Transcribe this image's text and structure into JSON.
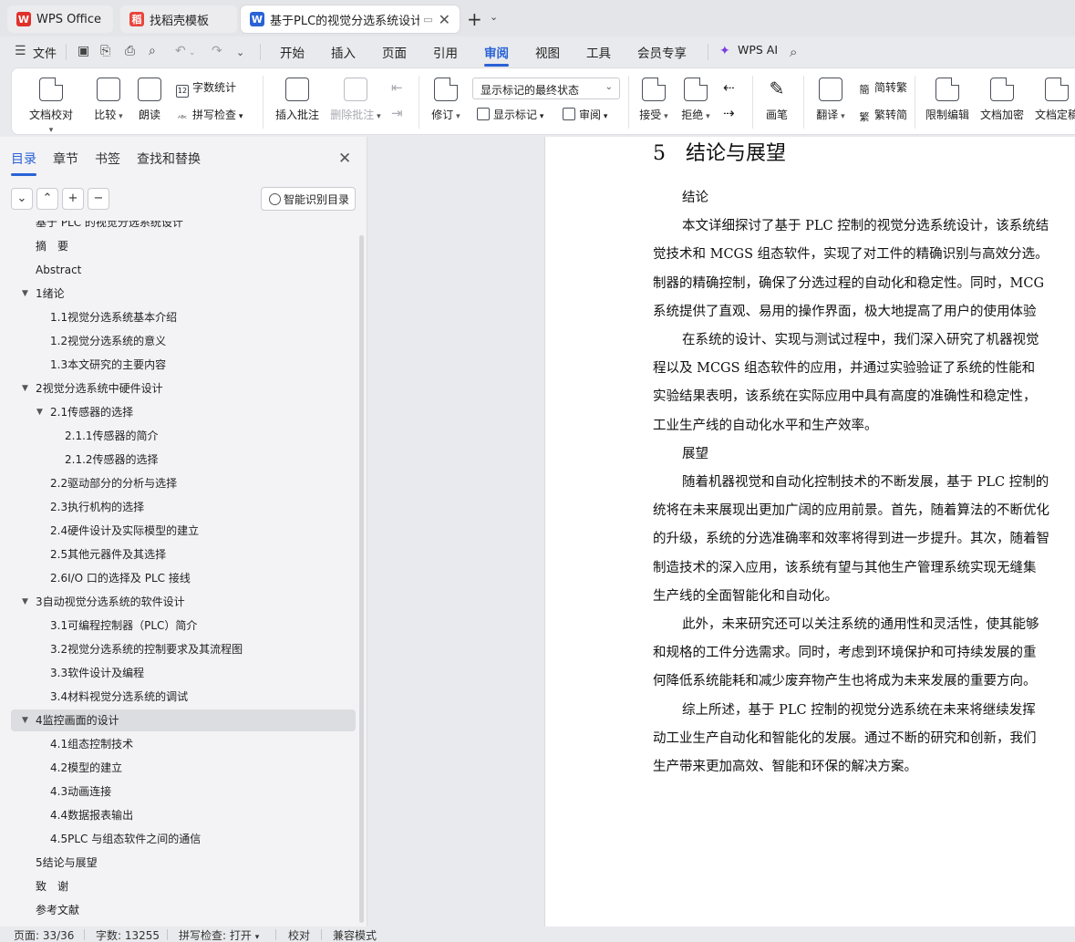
{
  "tabs": [
    {
      "label": "WPS Office"
    },
    {
      "label": "找稻壳模板"
    },
    {
      "label": "基于PLC的视觉分选系统设计"
    }
  ],
  "menu": {
    "file": "文件",
    "items": [
      "开始",
      "插入",
      "页面",
      "引用",
      "审阅",
      "视图",
      "工具",
      "会员专享"
    ],
    "active": "审阅",
    "ai": "WPS AI"
  },
  "ribbon": {
    "proofread": "文档校对",
    "compare": "比较",
    "read_aloud": "朗读",
    "word_count": "字数统计",
    "spell_check": "拼写检查",
    "insert_comment": "插入批注",
    "delete_comment": "删除批注",
    "track": "修订",
    "markup_state": "显示标记的最终状态",
    "show_markup": "显示标记",
    "review": "审阅",
    "accept": "接受",
    "reject": "拒绝",
    "pen": "画笔",
    "translate": "翻译",
    "to_traditional": "简转繁",
    "to_simplified": "繁转简",
    "restrict_edit": "限制编辑",
    "encrypt": "文档加密",
    "finalize": "文档定稿"
  },
  "nav": {
    "tabs": [
      "目录",
      "章节",
      "书签",
      "查找和替换"
    ],
    "smart_toc": "智能识别目录",
    "toc": [
      {
        "text": "基于 PLC 的视觉分选系统设计",
        "level": 0
      },
      {
        "text": "摘　要",
        "level": 0
      },
      {
        "text": "Abstract",
        "level": 0
      },
      {
        "text": "1绪论",
        "level": 0,
        "expanded": true
      },
      {
        "text": "1.1视觉分选系统基本介绍",
        "level": 1
      },
      {
        "text": "1.2视觉分选系统的意义",
        "level": 1
      },
      {
        "text": "1.3本文研究的主要内容",
        "level": 1
      },
      {
        "text": "2视觉分选系统中硬件设计",
        "level": 0,
        "expanded": true
      },
      {
        "text": "2.1传感器的选择",
        "level": 1,
        "expanded": true
      },
      {
        "text": "2.1.1传感器的简介",
        "level": 2
      },
      {
        "text": "2.1.2传感器的选择",
        "level": 2
      },
      {
        "text": "2.2驱动部分的分析与选择",
        "level": 1
      },
      {
        "text": "2.3执行机构的选择",
        "level": 1
      },
      {
        "text": "2.4硬件设计及实际模型的建立",
        "level": 1
      },
      {
        "text": "2.5其他元器件及其选择",
        "level": 1
      },
      {
        "text": "2.6I/O 口的选择及 PLC 接线",
        "level": 1
      },
      {
        "text": "3自动视觉分选系统的软件设计",
        "level": 0,
        "expanded": true
      },
      {
        "text": "3.1可编程控制器（PLC）简介",
        "level": 1
      },
      {
        "text": "3.2视觉分选系统的控制要求及其流程图",
        "level": 1
      },
      {
        "text": "3.3软件设计及编程",
        "level": 1
      },
      {
        "text": "3.4材料视觉分选系统的调试",
        "level": 1
      },
      {
        "text": "4监控画面的设计",
        "level": 0,
        "expanded": true,
        "selected": true
      },
      {
        "text": "4.1组态控制技术",
        "level": 1
      },
      {
        "text": "4.2模型的建立",
        "level": 1
      },
      {
        "text": "4.3动画连接",
        "level": 1
      },
      {
        "text": "4.4数据报表输出",
        "level": 1
      },
      {
        "text": "4.5PLC 与组态软件之间的通信",
        "level": 1
      },
      {
        "text": "5结论与展望",
        "level": 0
      },
      {
        "text": "致　谢",
        "level": 0
      },
      {
        "text": "参考文献",
        "level": 0
      }
    ]
  },
  "document": {
    "heading": "5　结论与展望",
    "lines": [
      {
        "text": "结论",
        "indent": true
      },
      {
        "text": "本文详细探讨了基于 PLC 控制的视觉分选系统设计，该系统结",
        "indent": true
      },
      {
        "text": "觉技术和 MCGS 组态软件，实现了对工件的精确识别与高效分选。",
        "indent": false
      },
      {
        "text": "制器的精确控制，确保了分选过程的自动化和稳定性。同时，MCG",
        "indent": false
      },
      {
        "text": "系统提供了直观、易用的操作界面，极大地提高了用户的使用体验",
        "indent": false
      },
      {
        "text": "在系统的设计、实现与测试过程中，我们深入研究了机器视觉",
        "indent": true
      },
      {
        "text": "程以及 MCGS 组态软件的应用，并通过实验验证了系统的性能和",
        "indent": false
      },
      {
        "text": "实验结果表明，该系统在实际应用中具有高度的准确性和稳定性，",
        "indent": false
      },
      {
        "text": "工业生产线的自动化水平和生产效率。",
        "indent": false
      },
      {
        "text": "展望",
        "indent": true
      },
      {
        "text": "随着机器视觉和自动化控制技术的不断发展，基于 PLC 控制的",
        "indent": true
      },
      {
        "text": "统将在未来展现出更加广阔的应用前景。首先，随着算法的不断优化",
        "indent": false
      },
      {
        "text": "的升级，系统的分选准确率和效率将得到进一步提升。其次，随着智",
        "indent": false
      },
      {
        "text": "制造技术的深入应用，该系统有望与其他生产管理系统实现无缝集",
        "indent": false
      },
      {
        "text": "生产线的全面智能化和自动化。",
        "indent": false
      },
      {
        "text": "此外，未来研究还可以关注系统的通用性和灵活性，使其能够",
        "indent": true
      },
      {
        "text": "和规格的工件分选需求。同时，考虑到环境保护和可持续发展的重",
        "indent": false
      },
      {
        "text": "何降低系统能耗和减少废弃物产生也将成为未来发展的重要方向。",
        "indent": false
      },
      {
        "text": "综上所述，基于 PLC 控制的视觉分选系统在未来将继续发挥",
        "indent": true
      },
      {
        "text": "动工业生产自动化和智能化的发展。通过不断的研究和创新，我们",
        "indent": false
      },
      {
        "text": "生产带来更加高效、智能和环保的解决方案。",
        "indent": false
      }
    ]
  },
  "status": {
    "page": "页面: 33/36",
    "words": "字数: 13255",
    "spell": "拼写检查: 打开",
    "proof": "校对",
    "compat": "兼容模式"
  },
  "colors": {
    "accent": "#2a62d6",
    "wps_red": "#e0302a"
  }
}
